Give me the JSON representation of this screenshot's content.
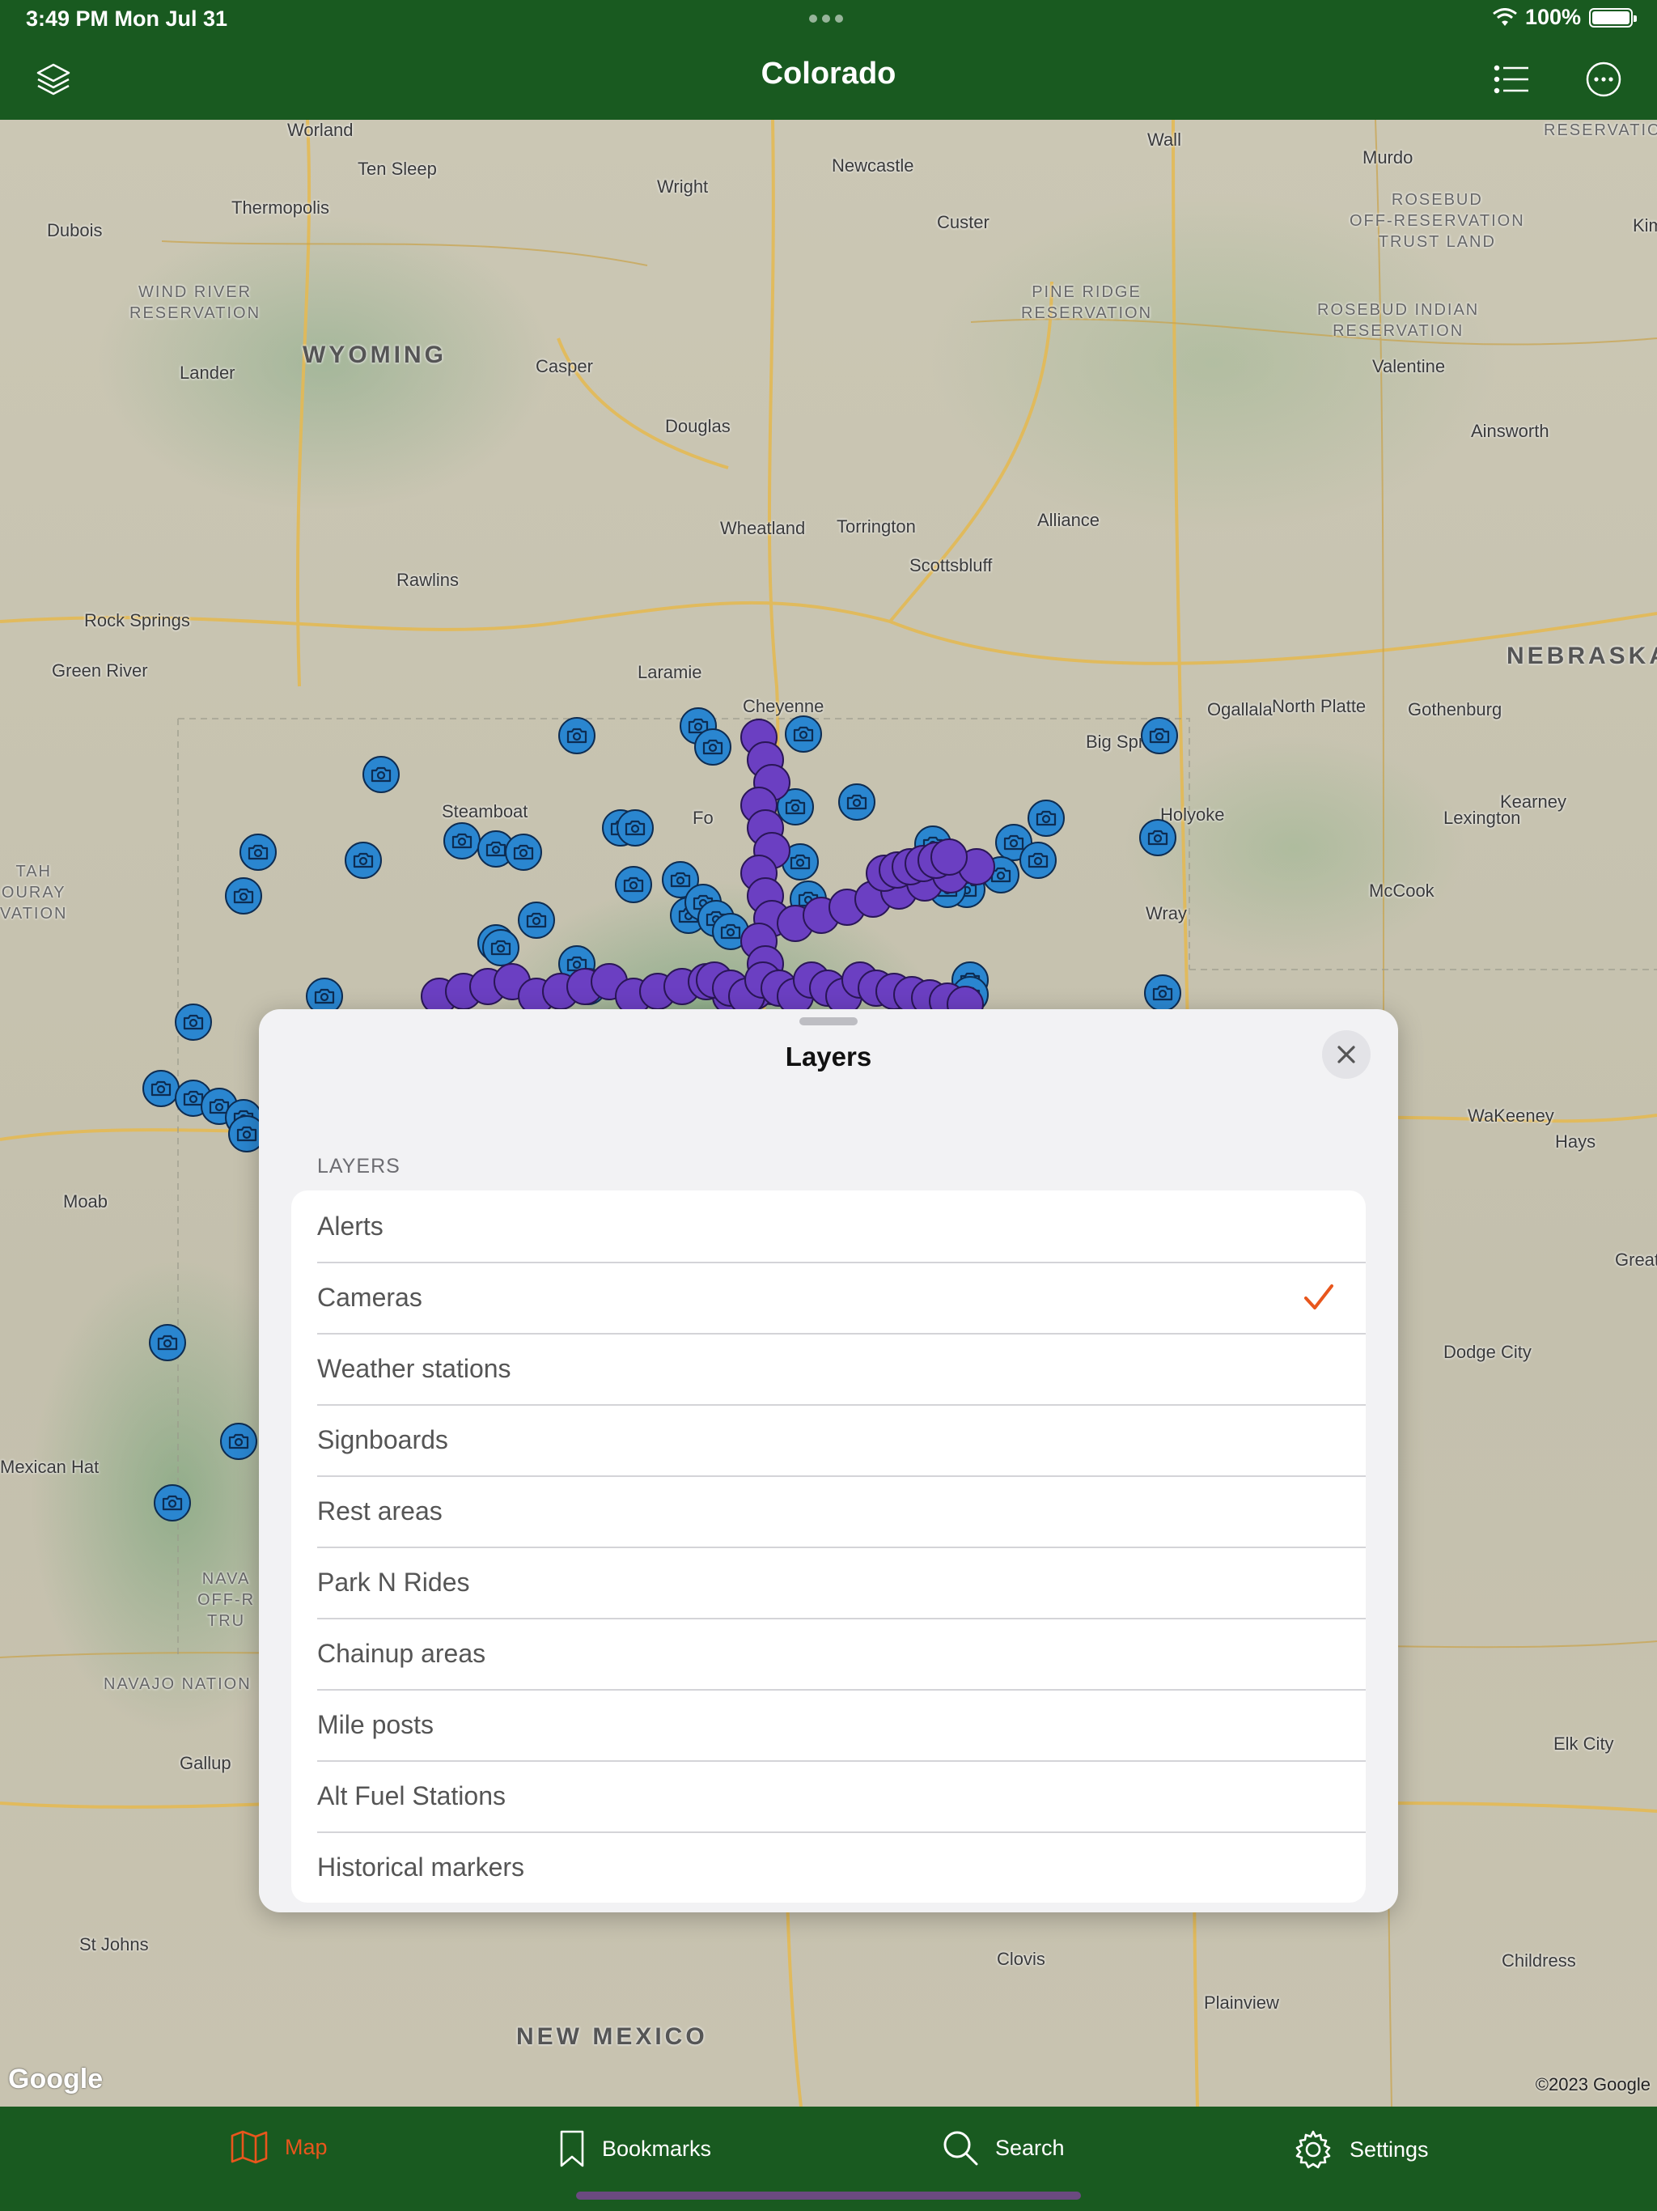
{
  "status": {
    "time": "3:49 PM   Mon Jul 31",
    "battery": "100%"
  },
  "nav": {
    "title": "Colorado"
  },
  "map": {
    "states": [
      "WYOMING",
      "NEBRASKA",
      "NEW MEXICO"
    ],
    "places": [
      "Worland",
      "Ten Sleep",
      "Thermopolis",
      "Dubois",
      "Lander",
      "Casper",
      "Douglas",
      "Wright",
      "Newcastle",
      "Custer",
      "Wall",
      "Murdo",
      "Valentine",
      "Ainsworth",
      "Alliance",
      "Scottsbluff",
      "Torrington",
      "Wheatland",
      "Rawlins",
      "Rock Springs",
      "Green River",
      "Laramie",
      "Cheyenne",
      "Ogallala",
      "North Platte",
      "Gothenburg",
      "Lexington",
      "Kearney",
      "McCook",
      "Wray",
      "Holyoke",
      "Big Spr",
      "Steamboat",
      "WaKeeney",
      "Hays",
      "Great Ben",
      "Dodge City",
      "Elk City",
      "Moab",
      "Mexican Hat",
      "Gallup",
      "St Johns",
      "Clovis",
      "Plainview",
      "Childress",
      "Fo",
      "Kimb"
    ],
    "reservations": [
      "WIND RIVER\nRESERVATION",
      "PINE RIDGE\nRESERVATION",
      "ROSEBUD\nOFF-RESERVATION\nTRUST LAND",
      "ROSEBUD INDIAN\nRESERVATION",
      "RESERVATION",
      "NAVAJO NATION",
      "NAVA\nOFF-R\nTRU",
      "TAH\nOURAY\nVATION"
    ],
    "google": "Google",
    "copyright": "©2023 Google"
  },
  "sheet": {
    "title": "Layers",
    "section": "LAYERS",
    "items": [
      {
        "label": "Alerts",
        "checked": false
      },
      {
        "label": "Cameras",
        "checked": true
      },
      {
        "label": "Weather stations",
        "checked": false
      },
      {
        "label": "Signboards",
        "checked": false
      },
      {
        "label": "Rest areas",
        "checked": false
      },
      {
        "label": "Park N Rides",
        "checked": false
      },
      {
        "label": "Chainup areas",
        "checked": false
      },
      {
        "label": "Mile posts",
        "checked": false
      },
      {
        "label": "Alt Fuel Stations",
        "checked": false
      },
      {
        "label": "Historical markers",
        "checked": false
      }
    ],
    "check_color": "#e8561c"
  },
  "tabs": [
    {
      "label": "Map",
      "icon": "map-icon",
      "active": true
    },
    {
      "label": "Bookmarks",
      "icon": "bookmark-icon",
      "active": false
    },
    {
      "label": "Search",
      "icon": "search-icon",
      "active": false
    },
    {
      "label": "Settings",
      "icon": "gear-icon",
      "active": false
    }
  ],
  "colors": {
    "nav_green": "#195a20",
    "accent_orange": "#e8561c",
    "camera_blue": "#2a86d0",
    "video_purple": "#6b3fc2"
  }
}
